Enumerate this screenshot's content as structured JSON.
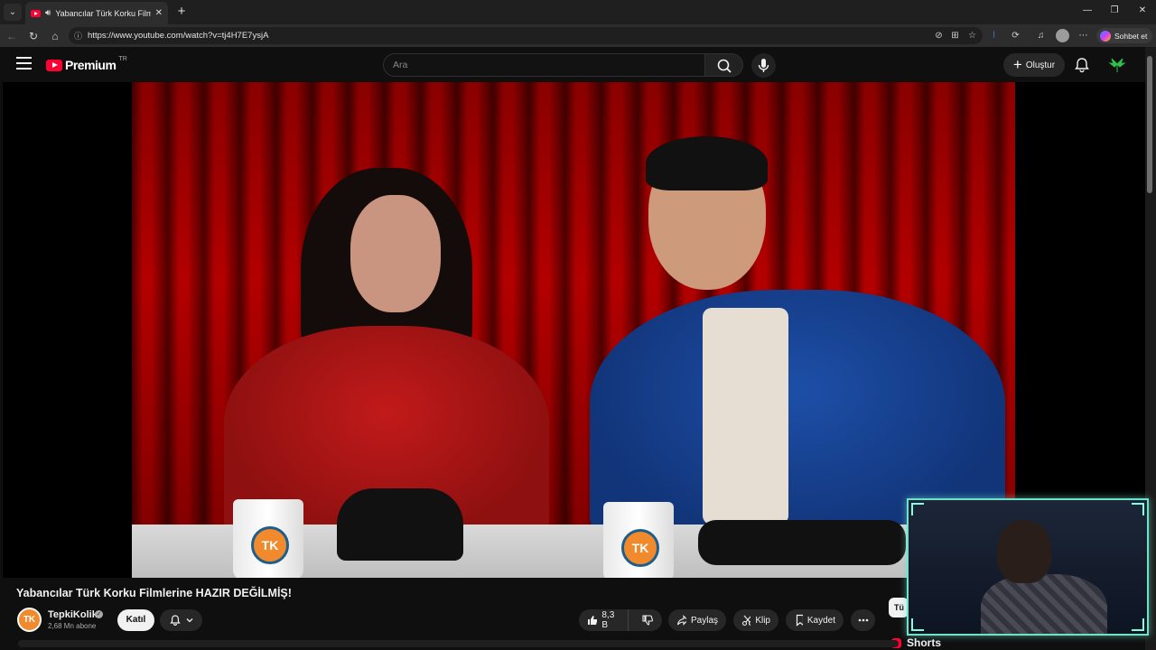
{
  "browser": {
    "tab_title": "Yabancılar Türk Korku Filmlerine HAZIR DEĞİLMİŞ!",
    "url": "https://www.youtube.com/watch?v=tj4H7E7ysjA",
    "copilot_label": "Sohbet et",
    "icons": [
      "tab-list-icon",
      "speaker-icon",
      "close-icon",
      "new-tab-icon",
      "back-icon",
      "refresh-icon",
      "home-icon",
      "info-icon",
      "translate-icon",
      "grid-icon",
      "star-icon",
      "extension-icon",
      "collections-icon",
      "profile-icon",
      "more-icon",
      "minimize-icon",
      "restore-icon",
      "window-close-icon"
    ]
  },
  "header": {
    "logo_text": "Premium",
    "logo_region": "TR",
    "search_placeholder": "Ara",
    "create_label": "Oluştur",
    "accent_color": "#ff0033"
  },
  "video": {
    "title": "Yabancılar Türk Korku Filmlerine HAZIR DEĞİLMİŞ!",
    "mug_logo": "TK"
  },
  "channel": {
    "avatar_text": "TK",
    "name": "TepkiKolik",
    "subscribers": "2,68 Mn abone",
    "join_label": "Katıl"
  },
  "actions": {
    "like_count": "8,3 B",
    "share_label": "Paylaş",
    "clip_label": "Klip",
    "save_label": "Kaydet"
  },
  "sidebar": {
    "chip_label": "Tü",
    "shorts_label": "Shorts"
  }
}
